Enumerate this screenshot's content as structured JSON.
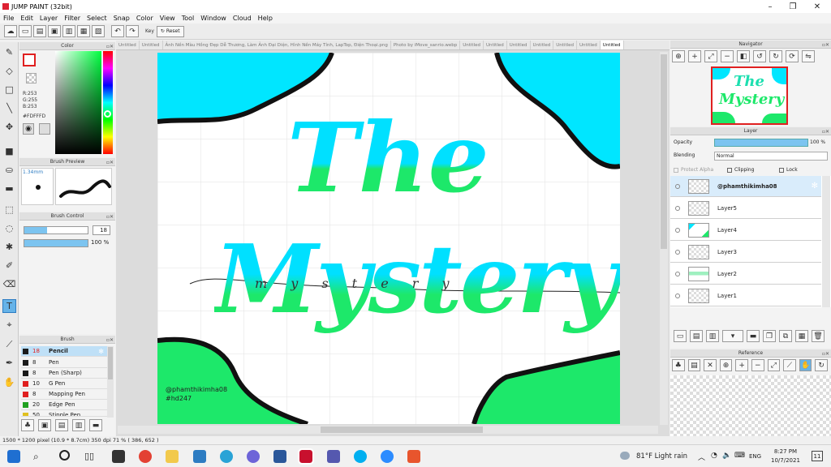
{
  "window": {
    "title": "JUMP PAINT (32bit)"
  },
  "menu": [
    "File",
    "Edit",
    "Layer",
    "Filter",
    "Select",
    "Snap",
    "Color",
    "View",
    "Tool",
    "Window",
    "Cloud",
    "Help"
  ],
  "toolbar": {
    "key_label": "Key",
    "reset_label": "Reset"
  },
  "color_panel": {
    "title": "Color",
    "r": "R:253",
    "g": "G:255",
    "b": "B:253",
    "hex": "#FDFFFD"
  },
  "brush_preview": {
    "title": "Brush Preview",
    "size": "1.34mm"
  },
  "brush_control": {
    "title": "Brush Control",
    "size_value": "18",
    "opacity_value": "100 %"
  },
  "brush_list": {
    "title": "Brush",
    "items": [
      {
        "size": "18",
        "name": "Pencil",
        "color": "#1b1b1b"
      },
      {
        "size": "8",
        "name": "Pen",
        "color": "#1b1b1b"
      },
      {
        "size": "8",
        "name": "Pen (Sharp)",
        "color": "#1b1b1b"
      },
      {
        "size": "10",
        "name": "G Pen",
        "color": "#e02020"
      },
      {
        "size": "8",
        "name": "Mapping Pen",
        "color": "#e02020"
      },
      {
        "size": "20",
        "name": "Edge Pen",
        "color": "#20a020"
      },
      {
        "size": "50",
        "name": "Stipple Pen",
        "color": "#e0c020"
      }
    ]
  },
  "doc_tabs": [
    "Untitled",
    "Untitled",
    "Ảnh Nền Màu Hồng Đẹp Dễ Thương, Làm Ảnh Đại Diện, Hình Nền Máy Tính, LapTop, Điện Thoại.png",
    "Photo by iMove_sanrio.webp",
    "Untitled",
    "Untitled",
    "Untitled",
    "Untitled",
    "Untitled",
    "Untitled",
    "Untitled"
  ],
  "canvas": {
    "title_line1": "The",
    "title_line2": "Mystery",
    "script_text": "m y s t e r y",
    "credit_line1": "@phamthikimha08",
    "credit_line2": "#hd247"
  },
  "navigator": {
    "title": "Navigator"
  },
  "layer_panel": {
    "title": "Layer",
    "opacity_label": "Opacity",
    "opacity_value": "100 %",
    "blending_label": "Blending",
    "blending_value": "Normal",
    "protect_alpha": "Protect Alpha",
    "clipping": "Clipping",
    "lock": "Lock",
    "layers": [
      "@phamthikimha08",
      "Layer5",
      "Layer4",
      "Layer3",
      "Layer2",
      "Layer1"
    ]
  },
  "reference": {
    "title": "Reference"
  },
  "status": {
    "text": "1500 * 1200 pixel  (10.9 * 8.7cm)  350 dpi  71 %  ( 386, 652 )"
  },
  "taskbar": {
    "weather": "81°F  Light rain",
    "lang": "ENG",
    "time": "8:27 PM",
    "date": "10/7/2021"
  },
  "colors": {
    "cyan": "#00e6ff",
    "green": "#1de86a",
    "accent": "#2d7cc2"
  }
}
